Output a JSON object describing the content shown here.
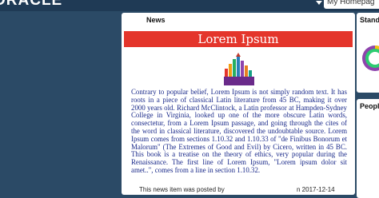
{
  "header": {
    "brand": "ORACLE",
    "homepage_label": "My Homepag"
  },
  "news": {
    "section_label": "News",
    "title": "Lorem Ipsum",
    "body": "Contrary to popular belief, Lorem Ipsum is not simply random text. It has roots in a piece of classical Latin literature from 45 BC, making it over 2000 years old. Richard McClintock, a Latin professor at Hampden-Sydney College in Virginia, looked up one of the more obscure Latin words, consectetur, from a Lorem Ipsum passage, and going through the cites of the word in classical literature, discovered the undoubtable source. Lorem Ipsum comes from sections 1.10.32 and 1.10.33 of \"de Finibus Bonorum et Malorum\" (The Extremes of Good and Evil) by Cicero, written in 45 BC. This book is a treatise on the theory of ethics, very popular during the Renaissance. The first line of Lorem Ipsum, \"Lorem ipsum dolor sit amet..\", comes from a line in section 1.10.32.",
    "posted_by": "This news item was posted by",
    "posted_on": "n 2017-12-14",
    "image_icon": "update-graphic-icon",
    "banner_color": "#e4352b"
  },
  "side": {
    "panel1_title": "Standi",
    "panel2_title": "Peopl",
    "panel1_icon": "circular-badge-icon"
  },
  "colors": {
    "background": "#2b4a66",
    "topbar": "#1f3a55",
    "body_text": "#1a2a8a"
  }
}
